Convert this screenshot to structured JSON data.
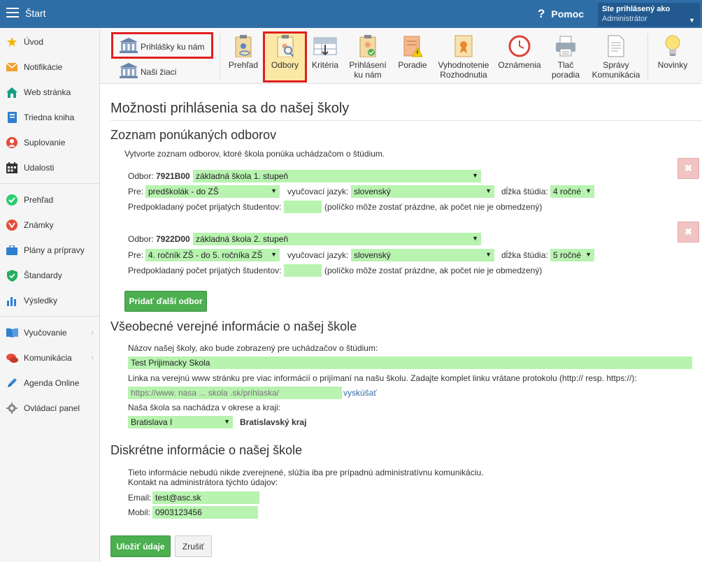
{
  "header": {
    "app_title": "Štart",
    "help_label": "Pomoc",
    "user_line1": "Ste prihlásený ako",
    "user_line2": "Administrátor"
  },
  "sidebar": {
    "items": [
      {
        "label": "Úvod",
        "icon": "star-icon"
      },
      {
        "label": "Notifikácie",
        "icon": "envelope-icon"
      },
      {
        "label": "Web stránka",
        "icon": "home-icon"
      },
      {
        "label": "Triedna kniha",
        "icon": "book-icon"
      },
      {
        "label": "Suplovanie",
        "icon": "person-icon"
      },
      {
        "label": "Udalosti",
        "icon": "calendar-icon"
      },
      {
        "label": "Prehľad",
        "icon": "check-circle-icon"
      },
      {
        "label": "Známky",
        "icon": "grade-icon"
      },
      {
        "label": "Plány a prípravy",
        "icon": "briefcase-icon"
      },
      {
        "label": "Štandardy",
        "icon": "shield-check-icon"
      },
      {
        "label": "Výsledky",
        "icon": "bar-chart-icon"
      },
      {
        "label": "Vyučovanie",
        "icon": "open-book-icon"
      },
      {
        "label": "Komunikácia",
        "icon": "chat-bubbles-icon"
      },
      {
        "label": "Agenda Online",
        "icon": "pen-icon"
      },
      {
        "label": "Ovládací panel",
        "icon": "gear-icon"
      }
    ]
  },
  "toolbar": {
    "left_buttons": [
      "Prihlášky ku nám",
      "Naši žiaci"
    ],
    "buttons": [
      {
        "line1": "Prehľad",
        "line2": ""
      },
      {
        "line1": "Odbory",
        "line2": ""
      },
      {
        "line1": "Kritéria",
        "line2": ""
      },
      {
        "line1": "Prihlásení",
        "line2": "ku nám"
      },
      {
        "line1": "Poradie",
        "line2": ""
      },
      {
        "line1": "Vyhodnotenie",
        "line2": "Rozhodnutia"
      },
      {
        "line1": "Oznámenia",
        "line2": ""
      },
      {
        "line1": "Tlač",
        "line2": "poradia"
      },
      {
        "line1": "Správy",
        "line2": "Komunikácia"
      },
      {
        "line1": "Novinky",
        "line2": ""
      }
    ]
  },
  "page": {
    "title": "Možnosti prihlásenia sa do našej školy",
    "section1": {
      "title": "Zoznam ponúkaných odborov",
      "intro": "Vytvorte zoznam odborov, ktoré škola ponúka uchádzačom o štúdium.",
      "label_odbor": "Odbor:",
      "label_pre": "Pre:",
      "label_language": "vyučovací jazyk:",
      "label_length": "dĺžka štúdia:",
      "label_count": "Predpokladaný počet prijatých študentov:",
      "count_hint": "(políčko môže zostať prázdne, ak počet nie je obmedzený)",
      "odbory": [
        {
          "code": "7921B00",
          "name": "základná škola 1. stupeň",
          "pre": "predškolák - do ZŠ",
          "language": "slovenský",
          "length": "4 ročné",
          "count": ""
        },
        {
          "code": "7922D00",
          "name": "základná škola 2. stupeň",
          "pre": "4. ročník ZŠ - do 5. ročníka ZŠ",
          "language": "slovenský",
          "length": "5 ročné",
          "count": ""
        }
      ],
      "delete_symbol": "✖",
      "add_button": "Pridať ďalší odbor"
    },
    "section2": {
      "title": "Všeobecné verejné informácie o našej škole",
      "name_label": "Názov našej školy, ako bude zobrazený pre uchádzačov o štúdium:",
      "name_value": "Test Prijimacky Skola",
      "link_label": "Linka na verejnú www stránku pre viac informácií o prijímaní na našu školu. Zadajte komplet linku vrátane protokolu (http:// resp. https://):",
      "link_placeholder": "https://www. nasa ... skola .sk/prihlaska/",
      "try_link": "vyskúšať",
      "region_label": "Naša škola sa nachádza v okrese a kraji:",
      "district": "Bratislava I",
      "region": "Bratislavský kraj"
    },
    "section3": {
      "title": "Diskrétne informácie o našej škole",
      "info_line1": "Tieto informácie nebudú nikde zverejnené, slúžia iba pre prípadnú administratívnu komunikáciu.",
      "info_line2": "Kontakt na administrátora týchto údajov:",
      "email_label": "Email:",
      "email_value": "test@asc.sk",
      "mobile_label": "Mobil:",
      "mobile_value": "0903123456"
    },
    "save_button": "Uložiť údaje",
    "cancel_button": "Zrušiť"
  }
}
